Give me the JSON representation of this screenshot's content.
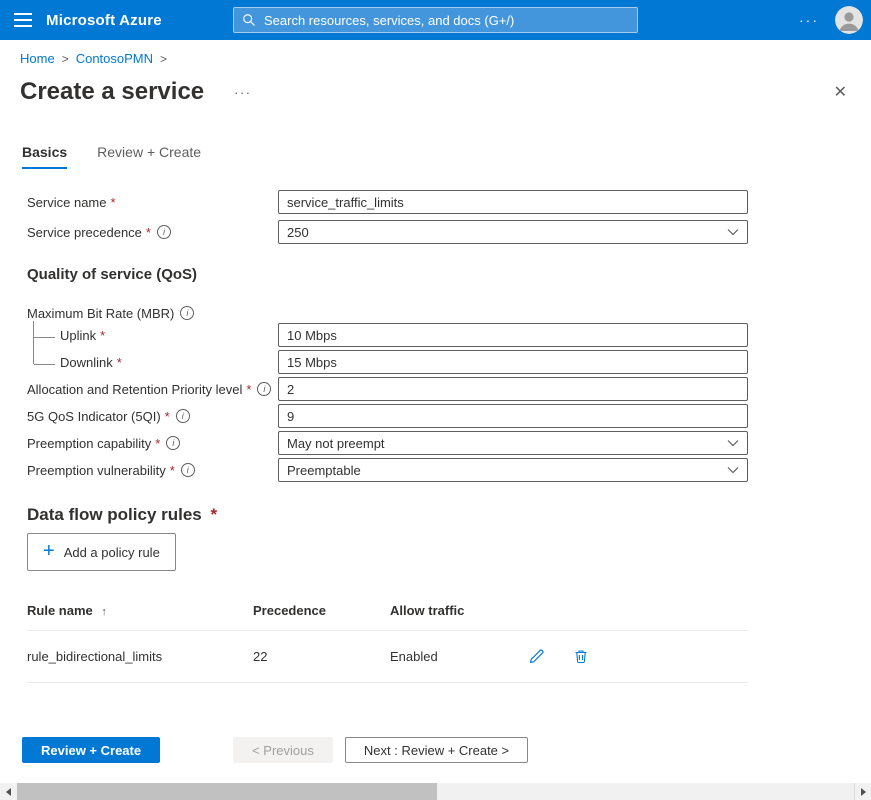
{
  "colors": {
    "accent": "#0078d4",
    "topbar": "#0078d4",
    "text": "#323130",
    "muted": "#605e5c",
    "required": "#a4262c"
  },
  "icons": {
    "ellipsis": "···",
    "close": "✕",
    "info": "i",
    "sort_asc": "↑",
    "plus": "+"
  },
  "topbar": {
    "brand": "Microsoft Azure",
    "search_placeholder": "Search resources, services, and docs (G+/)"
  },
  "breadcrumb": {
    "home": "Home",
    "resource": "ContosoPMN",
    "separator": ">"
  },
  "page": {
    "title": "Create a service"
  },
  "tabs": {
    "basics": "Basics",
    "review": "Review + Create"
  },
  "required_marker": "*",
  "form": {
    "service_name_label": "Service name",
    "service_name_value": "service_traffic_limits",
    "service_precedence_label": "Service precedence",
    "service_precedence_value": "250",
    "qos_heading": "Quality of service (QoS)",
    "mbr_label": "Maximum Bit Rate (MBR)",
    "uplink_label": "Uplink",
    "uplink_value": "10 Mbps",
    "downlink_label": "Downlink",
    "downlink_value": "15 Mbps",
    "arp_label": "Allocation and Retention Priority level",
    "arp_value": "2",
    "fiveqi_label": "5G QoS Indicator (5QI)",
    "fiveqi_value": "9",
    "preemption_capability_label": "Preemption capability",
    "preemption_capability_value": "May not preempt",
    "preemption_vulnerability_label": "Preemption vulnerability",
    "preemption_vulnerability_value": "Preemptable"
  },
  "policy_rules": {
    "heading": "Data flow policy rules",
    "add_button_label": "Add a policy rule",
    "table": {
      "headers": {
        "rule_name": "Rule name",
        "precedence": "Precedence",
        "allow_traffic": "Allow traffic"
      },
      "rows": [
        {
          "rule_name": "rule_bidirectional_limits",
          "precedence": "22",
          "allow_traffic": "Enabled"
        }
      ]
    }
  },
  "footer": {
    "review_create": "Review + Create",
    "previous": "< Previous",
    "next": "Next : Review + Create >"
  }
}
